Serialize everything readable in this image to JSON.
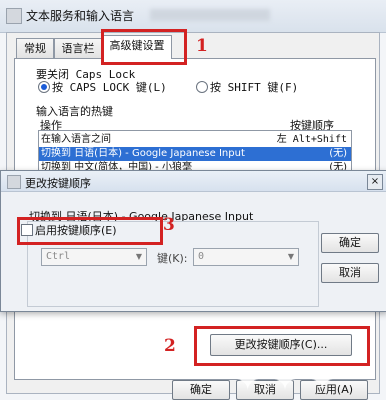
{
  "window": {
    "title": "文本服务和输入语言"
  },
  "tabs": [
    {
      "label": "常规"
    },
    {
      "label": "语言栏"
    },
    {
      "label": "高级键设置"
    }
  ],
  "capslock": {
    "heading": "要关闭 Caps Lock",
    "option1": "按 CAPS LOCK 键(L)",
    "option2": "按 SHIFT 键(F)"
  },
  "hotkeys": {
    "heading": "输入语言的热键",
    "col_action": "操作",
    "col_sequence": "按键顺序",
    "rows": [
      {
        "action": "在输入语言之间",
        "seq": "左 Alt+Shift"
      },
      {
        "action": "切换到 日语(日本) - Google Japanese Input",
        "seq": "(无)"
      },
      {
        "action": "切换到 中文(简体，中国) - 小狼毫",
        "seq": "(无)"
      }
    ],
    "change_button": "更改按键顺序(C)..."
  },
  "bottom_buttons": {
    "ok": "确定",
    "cancel": "取消",
    "apply": "应用(A)"
  },
  "dialog": {
    "title": "更改按键顺序",
    "subtitle": "切换到 日语(日本) - Google Japanese Input",
    "enable_checkbox": "启用按键顺序(E)",
    "modifier_value": "Ctrl",
    "key_label": "键(K):",
    "key_value": "0",
    "ok": "确定",
    "cancel": "取消",
    "close_glyph": "×"
  },
  "annotations": {
    "n1": "1",
    "n2": "2",
    "n3": "3"
  }
}
